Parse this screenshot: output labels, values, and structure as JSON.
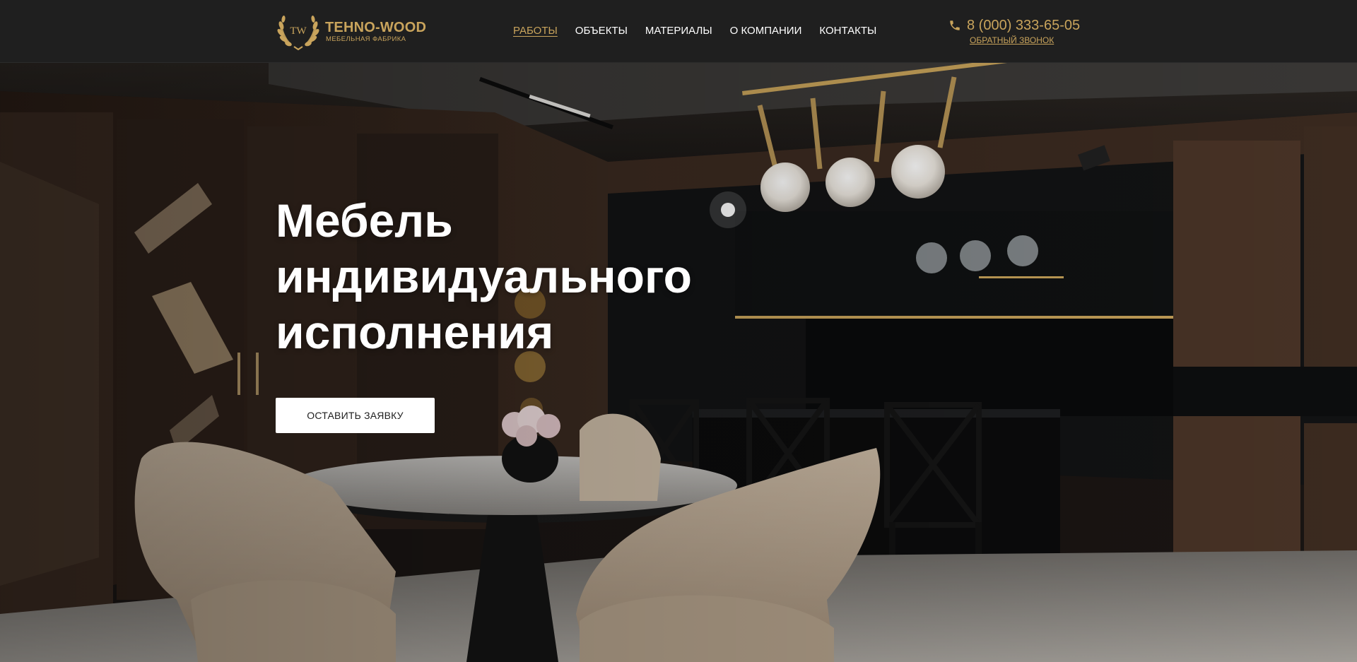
{
  "header": {
    "logo": {
      "monogram": "TW",
      "name": "TEHNO-WOOD",
      "tagline": "МЕБЕЛЬНАЯ ФАБРИКА"
    },
    "nav": [
      {
        "label": "РАБОТЫ",
        "active": true
      },
      {
        "label": "ОБЪЕКТЫ",
        "active": false
      },
      {
        "label": "МАТЕРИАЛЫ",
        "active": false
      },
      {
        "label": "О КОМПАНИИ",
        "active": false
      },
      {
        "label": "КОНТАКТЫ",
        "active": false
      }
    ],
    "phone": "8 (000) 333-65-05",
    "callback_label": "ОБРАТНЫЙ ЗВОНОК"
  },
  "hero": {
    "title_line1": "Мебель",
    "title_line2": "индивидуального",
    "title_line3": "исполнения",
    "cta_label": "ОСТАВИТЬ ЗАЯВКУ"
  },
  "colors": {
    "header_bg": "#1f1f1f",
    "accent_gold": "#c9a45c",
    "text_white": "#ffffff",
    "button_bg": "#ffffff"
  }
}
